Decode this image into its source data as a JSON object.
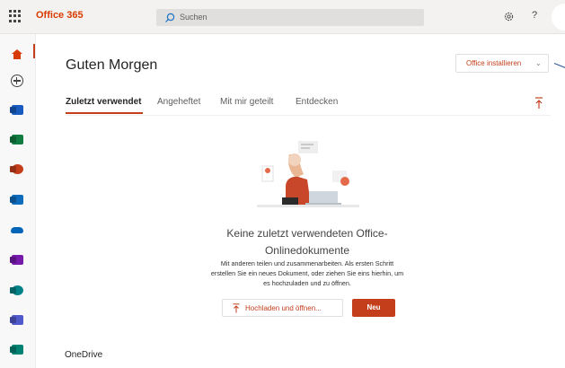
{
  "topbar": {
    "brand": "Office 365",
    "search_placeholder": "Suchen",
    "help_label": "?",
    "icons": [
      "app-launcher-icon",
      "search-icon",
      "gear-icon"
    ]
  },
  "rail": {
    "items": [
      {
        "name": "home",
        "icon": "home-icon",
        "color": "#d83b01",
        "active": true
      },
      {
        "name": "create",
        "icon": "add-circle-icon",
        "color": "#444444"
      },
      {
        "name": "word",
        "icon": "word-icon",
        "color": "#185abd"
      },
      {
        "name": "excel",
        "icon": "excel-icon",
        "color": "#107c41"
      },
      {
        "name": "powerpoint",
        "icon": "powerpoint-icon",
        "color": "#c43e1c"
      },
      {
        "name": "outlook",
        "icon": "outlook-icon",
        "color": "#0f6cbd"
      },
      {
        "name": "onedrive",
        "icon": "onedrive-icon",
        "color": "#0364b8"
      },
      {
        "name": "onenote",
        "icon": "onenote-icon",
        "color": "#7719aa"
      },
      {
        "name": "sharepoint",
        "icon": "sharepoint-icon",
        "color": "#038387"
      },
      {
        "name": "teams",
        "icon": "teams-icon",
        "color": "#5059c9"
      },
      {
        "name": "sway",
        "icon": "sway-icon",
        "color": "#008272"
      }
    ]
  },
  "main": {
    "greeting": "Guten Morgen",
    "install_button": "Office installieren",
    "tabs": [
      {
        "label": "Zuletzt verwendet",
        "active": true
      },
      {
        "label": "Angeheftet"
      },
      {
        "label": "Mit mir geteilt"
      },
      {
        "label": "Entdecken"
      }
    ],
    "empty": {
      "title_line1": "Keine zuletzt verwendeten Office-",
      "title_line2": "Onlinedokumente",
      "desc_line1": "Mit anderen teilen und zusammenarbeiten. Als ersten Schritt",
      "desc_line2": "erstellen Sie ein neues Dokument, oder ziehen Sie eins hierhin, um",
      "desc_line3": "es hochzuladen und zu öffnen."
    },
    "upload_button": "Hochladen und öffnen...",
    "new_button": "Neu",
    "section_heading": "OneDrive"
  },
  "colors": {
    "accent": "#c43e1c",
    "brand": "#d83b01"
  }
}
